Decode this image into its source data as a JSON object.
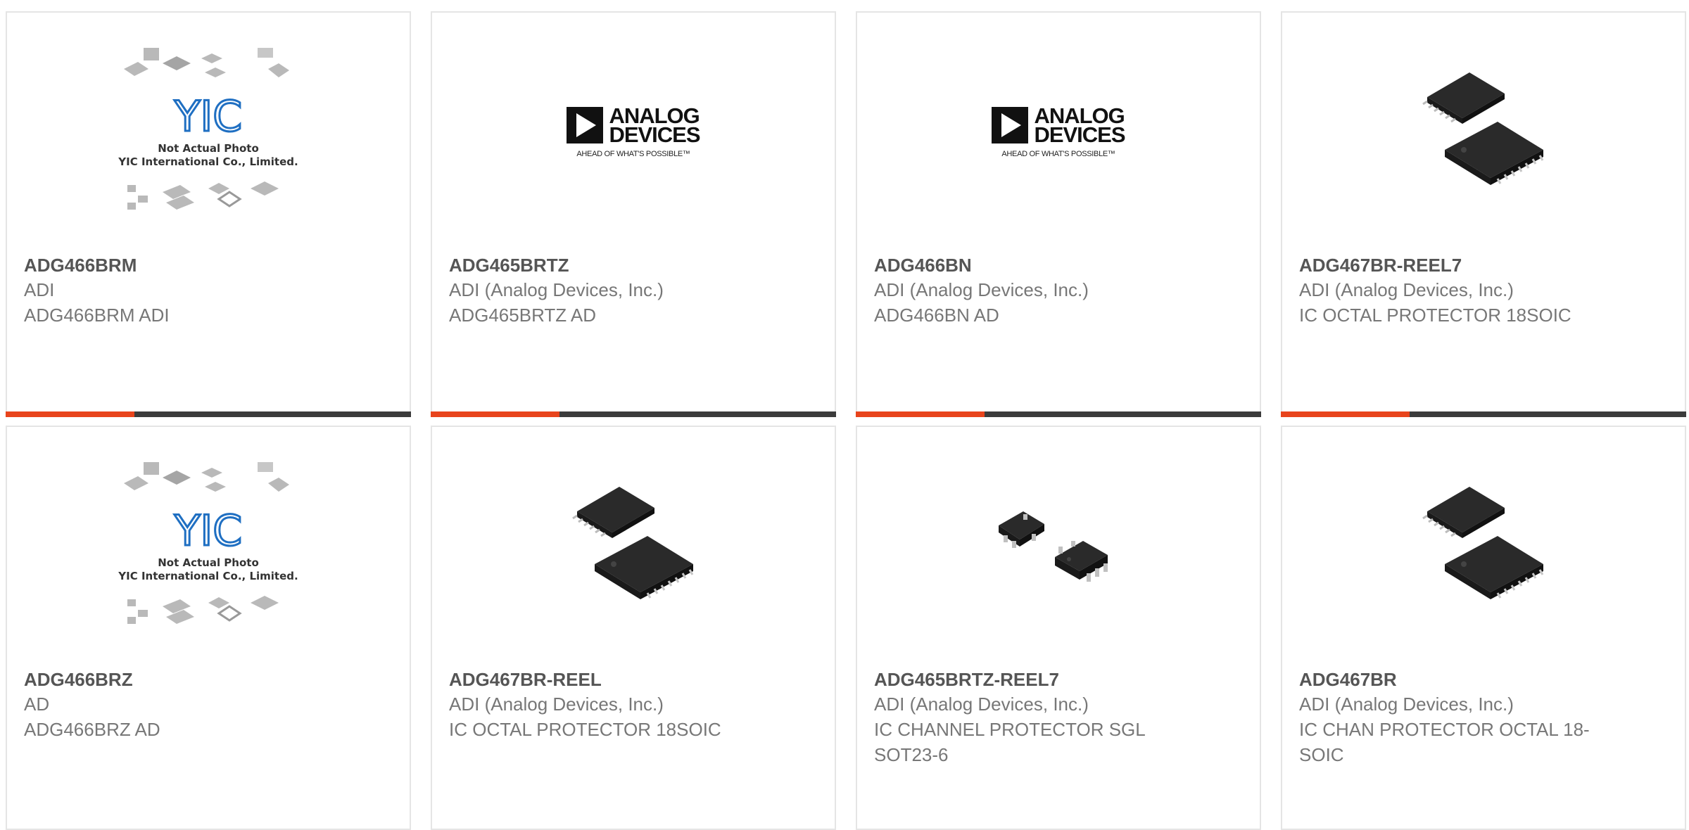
{
  "products": [
    {
      "part": "ADG466BRM",
      "brand": "ADI",
      "desc": "ADG466BRM ADI",
      "image": "yic-placeholder-image"
    },
    {
      "part": "ADG465BRTZ",
      "brand": "ADI (Analog Devices, Inc.)",
      "desc": "ADG465BRTZ AD",
      "image": "analog-devices-logo"
    },
    {
      "part": "ADG466BN",
      "brand": "ADI (Analog Devices, Inc.)",
      "desc": "ADG466BN AD",
      "image": "analog-devices-logo"
    },
    {
      "part": "ADG467BR-REEL7",
      "brand": "ADI (Analog Devices, Inc.)",
      "desc": "IC OCTAL PROTECTOR 18SOIC",
      "image": "soic-chip-image"
    },
    {
      "part": "ADG466BRZ",
      "brand": "AD",
      "desc": "ADG466BRZ AD",
      "image": "yic-placeholder-image"
    },
    {
      "part": "ADG467BR-REEL",
      "brand": "ADI (Analog Devices, Inc.)",
      "desc": "IC OCTAL PROTECTOR 18SOIC",
      "image": "soic-chip-image"
    },
    {
      "part": "ADG465BRTZ-REEL7",
      "brand": "ADI (Analog Devices, Inc.)",
      "desc": "IC CHANNEL PROTECTOR SGL SOT23-6",
      "image": "sot23-chip-image"
    },
    {
      "part": "ADG467BR",
      "brand": "ADI (Analog Devices, Inc.)",
      "desc": "IC CHAN PROTECTOR OCTAL 18-SOIC",
      "image": "soic-chip-image"
    }
  ],
  "yic": {
    "logo_text": "YIC",
    "line1": "Not Actual Photo",
    "line2": "YIC International Co., Limited."
  },
  "adi_logo": {
    "line1": "ANALOG",
    "line2": "DEVICES",
    "tagline": "AHEAD OF WHAT'S POSSIBLE™"
  },
  "colors": {
    "accent": "#e8441c",
    "bar": "#3b3b3b",
    "yic_blue": "#1f6fc2"
  }
}
